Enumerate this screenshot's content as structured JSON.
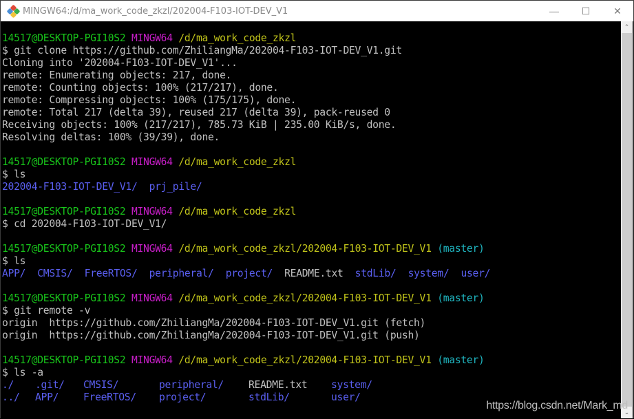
{
  "window": {
    "title": "MINGW64:/d/ma_work_code_zkzl/202004-F103-IOT-DEV_V1",
    "controls": {
      "minimize": "—",
      "maximize": "☐",
      "close": "✕"
    }
  },
  "colors": {
    "user_host": "#18c51a",
    "shell": "#c81ec8",
    "path": "#c0c31a",
    "branch": "#1fb5c0",
    "directory": "#5a5ff0",
    "text": "#c0c0c0",
    "background": "#000000"
  },
  "terminal": {
    "blocks": [
      {
        "prompt": {
          "user_host": "14517@DESKTOP-PGI10S2",
          "shell": "MINGW64",
          "path": "/d/ma_work_code_zkzl",
          "branch": ""
        },
        "command": "$ git clone https://github.com/ZhiliangMa/202004-F103-IOT-DEV_V1.git",
        "output": [
          "Cloning into '202004-F103-IOT-DEV_V1'...",
          "remote: Enumerating objects: 217, done.",
          "remote: Counting objects: 100% (217/217), done.",
          "remote: Compressing objects: 100% (175/175), done.",
          "remote: Total 217 (delta 39), reused 217 (delta 39), pack-reused 0",
          "Receiving objects: 100% (217/217), 785.73 KiB | 235.00 KiB/s, done.",
          "Resolving deltas: 100% (39/39), done."
        ]
      },
      {
        "prompt": {
          "user_host": "14517@DESKTOP-PGI10S2",
          "shell": "MINGW64",
          "path": "/d/ma_work_code_zkzl",
          "branch": ""
        },
        "command": "$ ls",
        "listing": [
          "202004-F103-IOT-DEV_V1/",
          "prj_pile/"
        ]
      },
      {
        "prompt": {
          "user_host": "14517@DESKTOP-PGI10S2",
          "shell": "MINGW64",
          "path": "/d/ma_work_code_zkzl",
          "branch": ""
        },
        "command": "$ cd 202004-F103-IOT-DEV_V1/"
      },
      {
        "prompt": {
          "user_host": "14517@DESKTOP-PGI10S2",
          "shell": "MINGW64",
          "path": "/d/ma_work_code_zkzl/202004-F103-IOT-DEV_V1",
          "branch": "(master)"
        },
        "command": "$ ls",
        "listing": [
          "APP/",
          "CMSIS/",
          "FreeRTOS/",
          "peripheral/",
          "project/",
          "README.txt",
          "stdLib/",
          "system/",
          "user/"
        ]
      },
      {
        "prompt": {
          "user_host": "14517@DESKTOP-PGI10S2",
          "shell": "MINGW64",
          "path": "/d/ma_work_code_zkzl/202004-F103-IOT-DEV_V1",
          "branch": "(master)"
        },
        "command": "$ git remote -v",
        "output": [
          "origin  https://github.com/ZhiliangMa/202004-F103-IOT-DEV_V1.git (fetch)",
          "origin  https://github.com/ZhiliangMa/202004-F103-IOT-DEV_V1.git (push)"
        ]
      },
      {
        "prompt": {
          "user_host": "14517@DESKTOP-PGI10S2",
          "shell": "MINGW64",
          "path": "/d/ma_work_code_zkzl/202004-F103-IOT-DEV_V1",
          "branch": "(master)"
        },
        "command": "$ ls -a",
        "listing_rows": [
          [
            "./",
            ".git/",
            "CMSIS/",
            "peripheral/",
            "README.txt",
            "system/"
          ],
          [
            "../",
            "APP/",
            "FreeRTOS/",
            "project/",
            "stdLib/",
            "user/"
          ]
        ]
      }
    ]
  },
  "scrollbar": {
    "up_icon": "⌃",
    "down_icon": "⌄"
  },
  "watermark": "https://blog.csdn.net/Mark_md"
}
